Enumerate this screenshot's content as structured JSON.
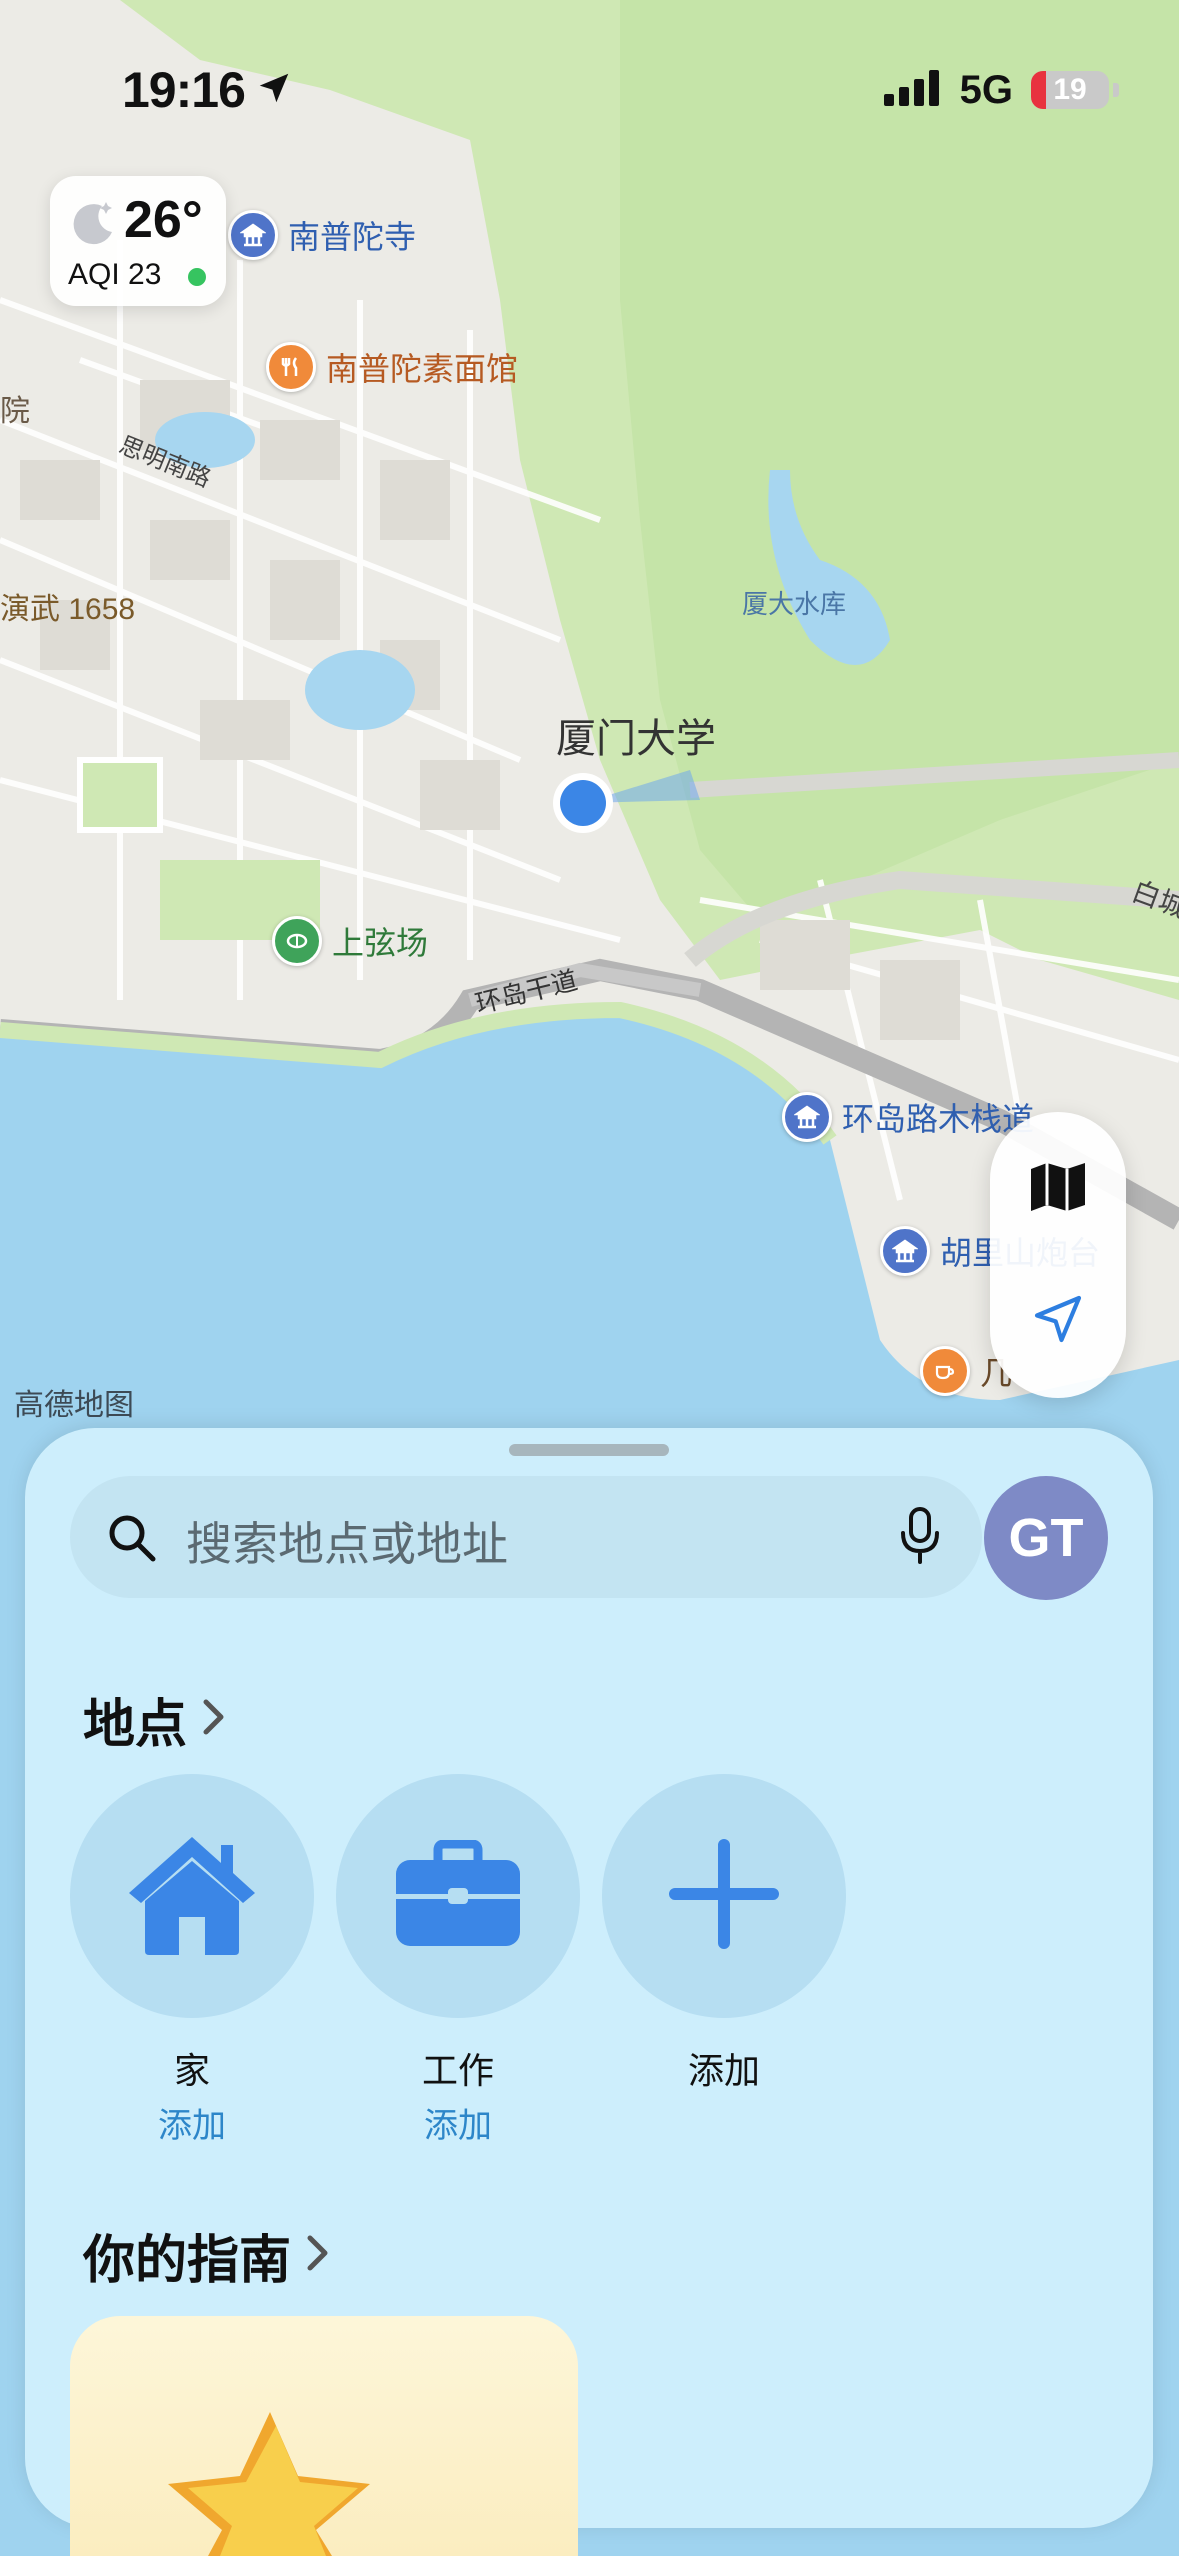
{
  "status_bar": {
    "time": "19:16",
    "network": "5G",
    "battery": "19",
    "battery_level": 0.19
  },
  "weather": {
    "temperature": "26°",
    "aqi": "AQI 23"
  },
  "map": {
    "labels": {
      "nanputuo_temple": "南普陀寺",
      "vegetarian": "南普陀素面馆",
      "yuan": "院",
      "siming_road": "思明南路",
      "yanwu": "演武 1658",
      "reservoir": "厦大水库",
      "university": "厦门大学",
      "shangxian": "上弦场",
      "huandao_road": "环岛干道",
      "boardwalk": "环岛路木栈道",
      "hulishan": "胡里山炮台",
      "bai": "白城",
      "ji": "几",
      "brand": "高德地图"
    }
  },
  "sheet": {
    "search_placeholder": "搜索地点或地址",
    "avatar_initials": "GT",
    "places_title": "地点",
    "places": [
      {
        "name": "家",
        "action": "添加",
        "icon": "home-icon"
      },
      {
        "name": "工作",
        "action": "添加",
        "icon": "briefcase-icon"
      },
      {
        "name": "添加",
        "icon": "plus-icon"
      }
    ],
    "guides_title": "你的指南"
  },
  "colors": {
    "accent": "#3b86e6",
    "water": "#9fd3ef",
    "park": "#cfe9b0",
    "sheet": "#cdeefc"
  }
}
